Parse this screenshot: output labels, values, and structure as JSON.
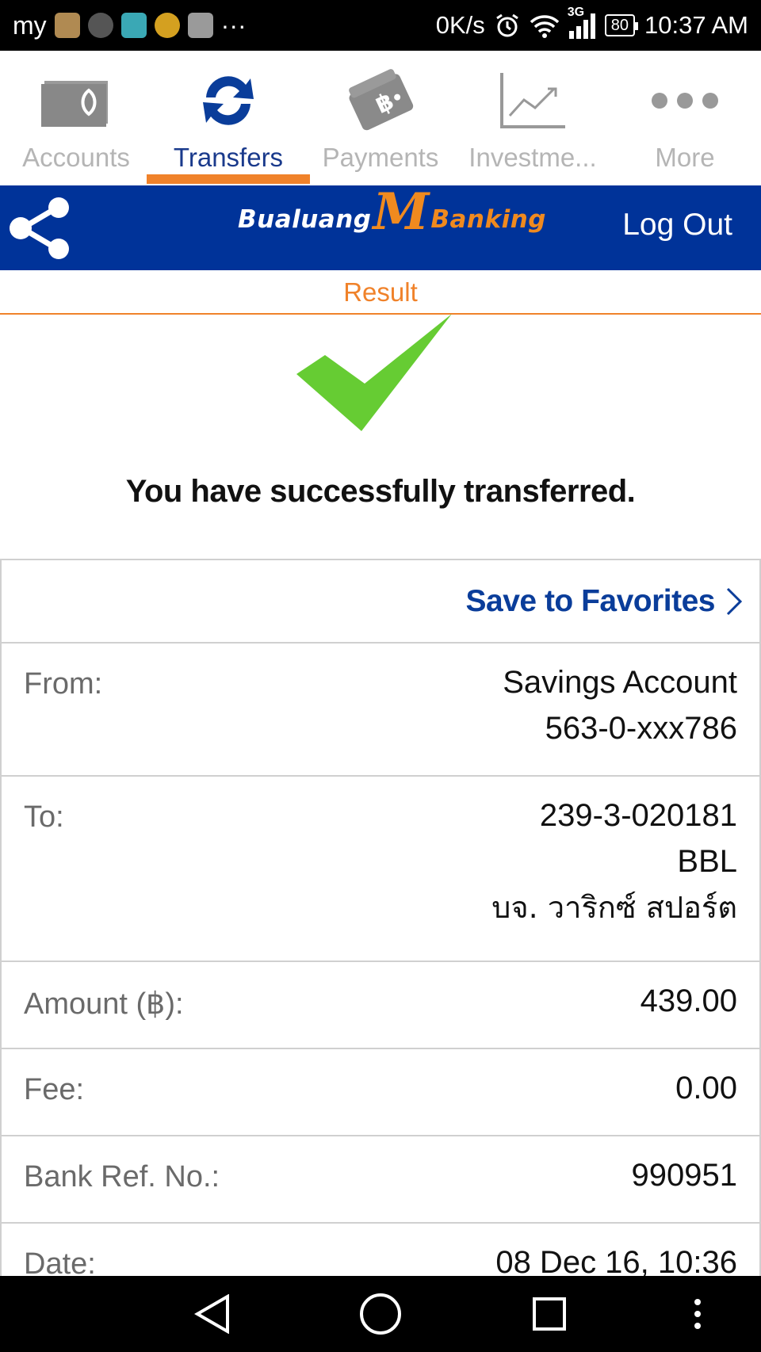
{
  "status_bar": {
    "carrier": "my",
    "more": "···",
    "speed": "0K/s",
    "network": "3G",
    "battery": "80",
    "time": "10:37 AM"
  },
  "tabs": [
    {
      "label": "Accounts",
      "icon": "wallet-icon",
      "active": false
    },
    {
      "label": "Transfers",
      "icon": "transfer-arrows-icon",
      "active": true
    },
    {
      "label": "Payments",
      "icon": "baht-card-icon",
      "active": false
    },
    {
      "label": "Investme...",
      "icon": "chart-line-icon",
      "active": false
    },
    {
      "label": "More",
      "icon": "more-dots-icon",
      "active": false
    }
  ],
  "header": {
    "logo_left": "Bualuang",
    "logo_m": "M",
    "logo_right": "Banking",
    "logout_label": "Log Out"
  },
  "result": {
    "title": "Result",
    "message": "You have successfully transferred."
  },
  "favorites": {
    "label": "Save to Favorites"
  },
  "details": {
    "from_label": "From:",
    "from_line1": "Savings Account",
    "from_line2": "563-0-xxx786",
    "to_label": "To:",
    "to_line1": "239-3-020181",
    "to_line2": "BBL",
    "to_line3": "บจ. วาริกซ์ สปอร์ต",
    "amount_label": "Amount (฿):",
    "amount_value": "439.00",
    "fee_label": "Fee:",
    "fee_value": "0.00",
    "ref_label": "Bank Ref. No.:",
    "ref_value": "990951",
    "date_label": "Date:",
    "date_value": "08 Dec 16, 10:36"
  },
  "colors": {
    "brand_blue": "#003399",
    "accent_orange": "#f0822a",
    "success_green": "#66cc33",
    "link_blue": "#0a3d9a"
  }
}
